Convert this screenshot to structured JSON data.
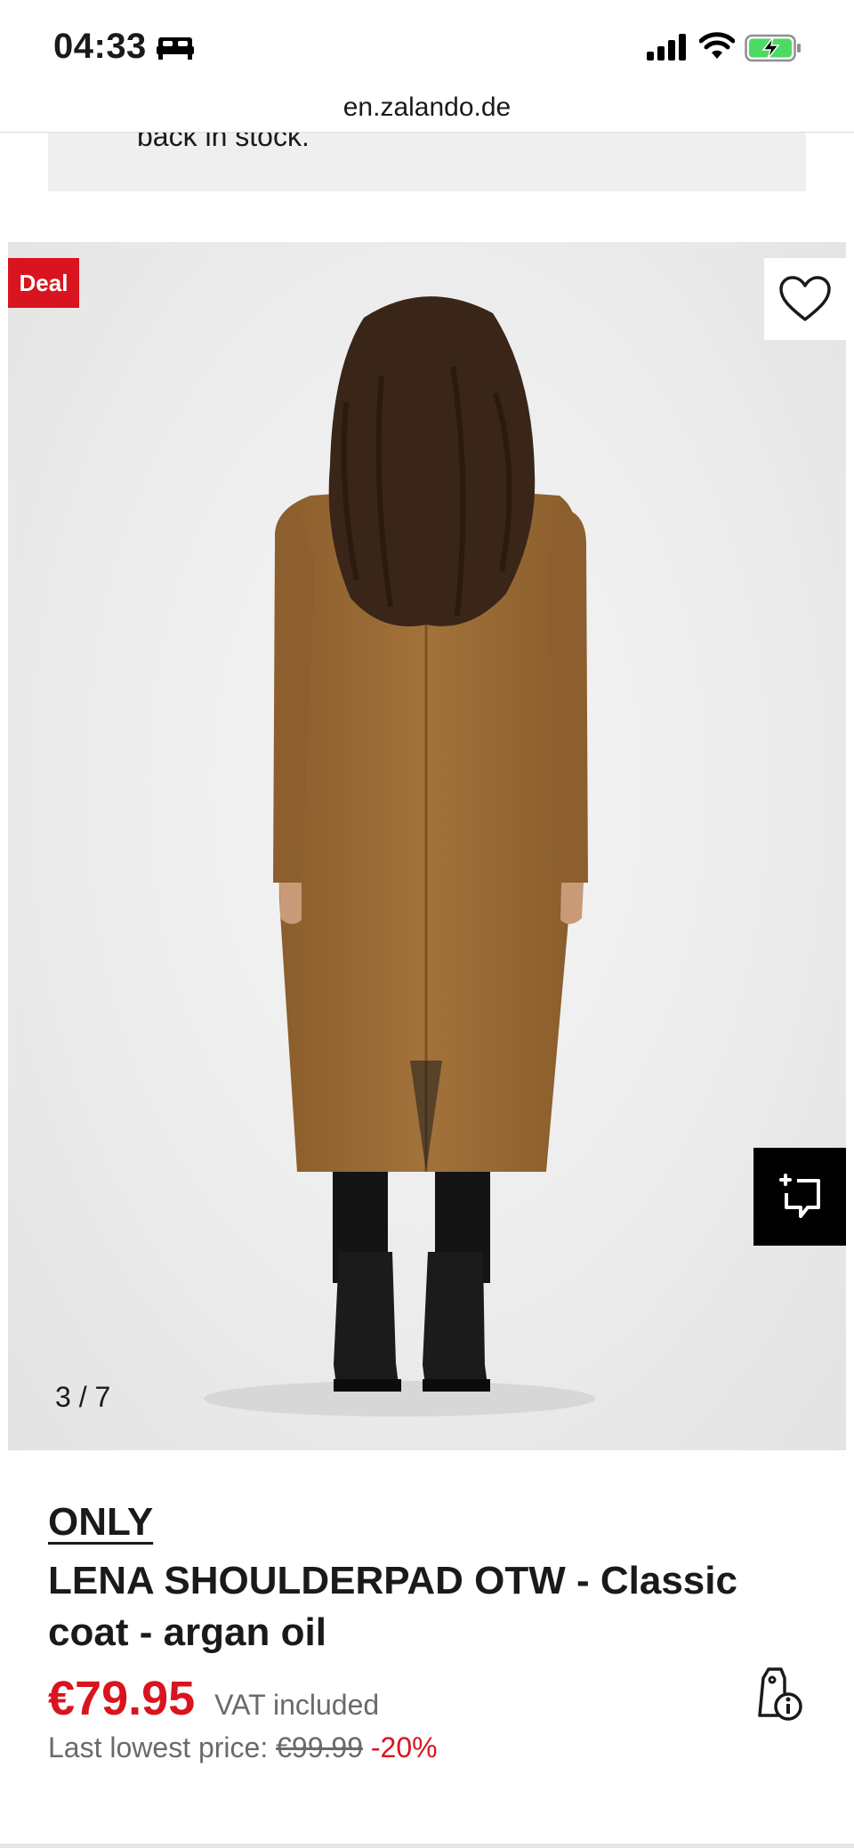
{
  "status_bar": {
    "time": "04:33",
    "icons": [
      "bed-icon",
      "signal-icon",
      "wifi-icon",
      "battery-charging-icon"
    ],
    "battery_color": "#4cd964"
  },
  "browser": {
    "url": "en.zalando.de"
  },
  "stock_notice": {
    "text": "back in stock."
  },
  "gallery": {
    "deal_label": "Deal",
    "counter": "3 / 7",
    "icons": [
      "heart-icon",
      "ar-view-icon"
    ]
  },
  "product": {
    "brand": "ONLY",
    "name": "LENA SHOULDERPAD OTW - Classic coat - argan oil",
    "price": "€79.95",
    "vat": "VAT included",
    "lowest_label": "Last lowest price:",
    "old_price": "€99.99",
    "discount": "-20%",
    "icons": [
      "price-tag-info-icon"
    ]
  },
  "colors": {
    "accent_red": "#d9141e",
    "coat": "#9a6a34",
    "text_dark": "#1a1a1a",
    "text_muted": "#6a6a6a"
  }
}
